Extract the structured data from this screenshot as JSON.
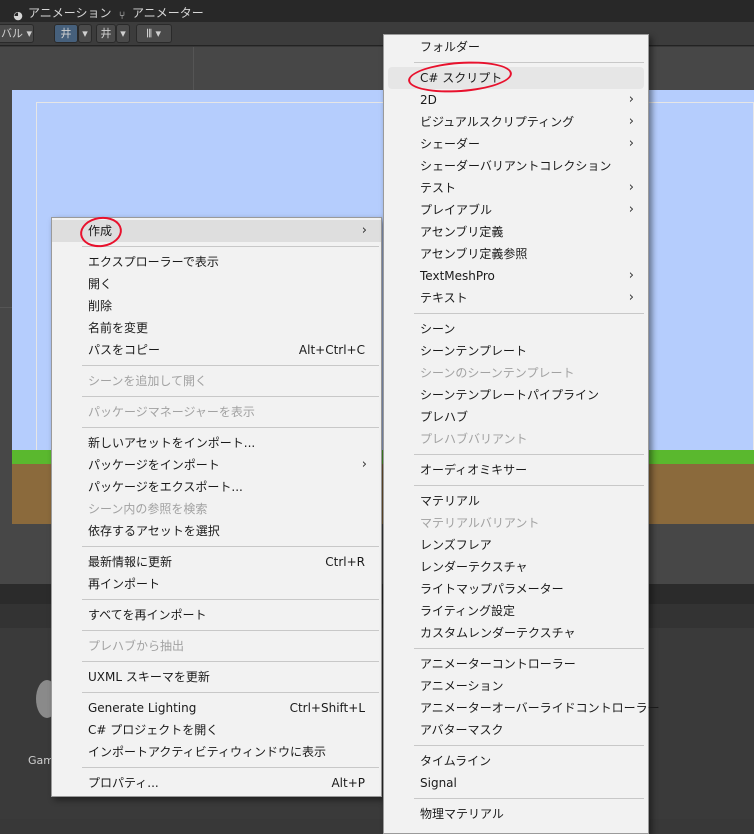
{
  "tabs": [
    {
      "icon": "animation-icon",
      "label": "アニメーション"
    },
    {
      "icon": "animator-icon",
      "label": "アニメーター"
    }
  ],
  "toolbar": {
    "left_dropdown": "バル",
    "button1": "井",
    "button2": "井",
    "button3": "𝄃𝄃"
  },
  "bottom_panel": {
    "partial_label": "Gam"
  },
  "context_menu": {
    "items": [
      {
        "label": "作成",
        "submenu": true,
        "highlighted": true
      },
      {
        "sep": true
      },
      {
        "label": "エクスプローラーで表示"
      },
      {
        "label": "開く"
      },
      {
        "label": "削除"
      },
      {
        "label": "名前を変更"
      },
      {
        "label": "パスをコピー",
        "shortcut": "Alt+Ctrl+C"
      },
      {
        "sep": true
      },
      {
        "label": "シーンを追加して開く",
        "disabled": true
      },
      {
        "sep": true
      },
      {
        "label": "パッケージマネージャーを表示",
        "disabled": true
      },
      {
        "sep": true
      },
      {
        "label": "新しいアセットをインポート..."
      },
      {
        "label": "パッケージをインポート",
        "submenu": true
      },
      {
        "label": "パッケージをエクスポート..."
      },
      {
        "label": "シーン内の参照を検索",
        "disabled": true
      },
      {
        "label": "依存するアセットを選択"
      },
      {
        "sep": true
      },
      {
        "label": "最新情報に更新",
        "shortcut": "Ctrl+R"
      },
      {
        "label": "再インポート"
      },
      {
        "sep": true
      },
      {
        "label": "すべてを再インポート"
      },
      {
        "sep": true
      },
      {
        "label": "プレハブから抽出",
        "disabled": true
      },
      {
        "sep": true
      },
      {
        "label": "UXML スキーマを更新"
      },
      {
        "sep": true
      },
      {
        "label": "Generate Lighting",
        "shortcut": "Ctrl+Shift+L"
      },
      {
        "label": "C# プロジェクトを開く"
      },
      {
        "label": "インポートアクティビティウィンドウに表示"
      },
      {
        "sep": true
      },
      {
        "label": "プロパティ...",
        "shortcut": "Alt+P"
      }
    ]
  },
  "create_submenu": {
    "items": [
      {
        "label": "フォルダー"
      },
      {
        "sep": true
      },
      {
        "label": "C# スクリプト",
        "highlighted": true
      },
      {
        "label": "2D",
        "submenu": true
      },
      {
        "label": "ビジュアルスクリプティング",
        "submenu": true
      },
      {
        "label": "シェーダー",
        "submenu": true
      },
      {
        "label": "シェーダーバリアントコレクション"
      },
      {
        "label": "テスト",
        "submenu": true
      },
      {
        "label": "プレイアブル",
        "submenu": true
      },
      {
        "label": "アセンブリ定義"
      },
      {
        "label": "アセンブリ定義参照"
      },
      {
        "label": "TextMeshPro",
        "submenu": true
      },
      {
        "label": "テキスト",
        "submenu": true
      },
      {
        "sep": true
      },
      {
        "label": "シーン"
      },
      {
        "label": "シーンテンプレート"
      },
      {
        "label": "シーンのシーンテンプレート",
        "disabled": true
      },
      {
        "label": "シーンテンプレートパイプライン"
      },
      {
        "label": "プレハブ"
      },
      {
        "label": "プレハブバリアント",
        "disabled": true
      },
      {
        "sep": true
      },
      {
        "label": "オーディオミキサー"
      },
      {
        "sep": true
      },
      {
        "label": "マテリアル"
      },
      {
        "label": "マテリアルバリアント",
        "disabled": true
      },
      {
        "label": "レンズフレア"
      },
      {
        "label": "レンダーテクスチャ"
      },
      {
        "label": "ライトマップパラメーター"
      },
      {
        "label": "ライティング設定"
      },
      {
        "label": "カスタムレンダーテクスチャ"
      },
      {
        "sep": true
      },
      {
        "label": "アニメーターコントローラー"
      },
      {
        "label": "アニメーション"
      },
      {
        "label": "アニメーターオーバーライドコントローラー"
      },
      {
        "label": "アバターマスク"
      },
      {
        "sep": true
      },
      {
        "label": "タイムライン"
      },
      {
        "label": "Signal"
      },
      {
        "sep": true
      },
      {
        "label": "物理マテリアル"
      }
    ]
  },
  "colors": {
    "sky": "#b5cdfd",
    "grass": "#5ab82e",
    "dirt": "#8b6a3c",
    "annotation_circle": "#e8112d"
  },
  "arrow_glyph": "›"
}
